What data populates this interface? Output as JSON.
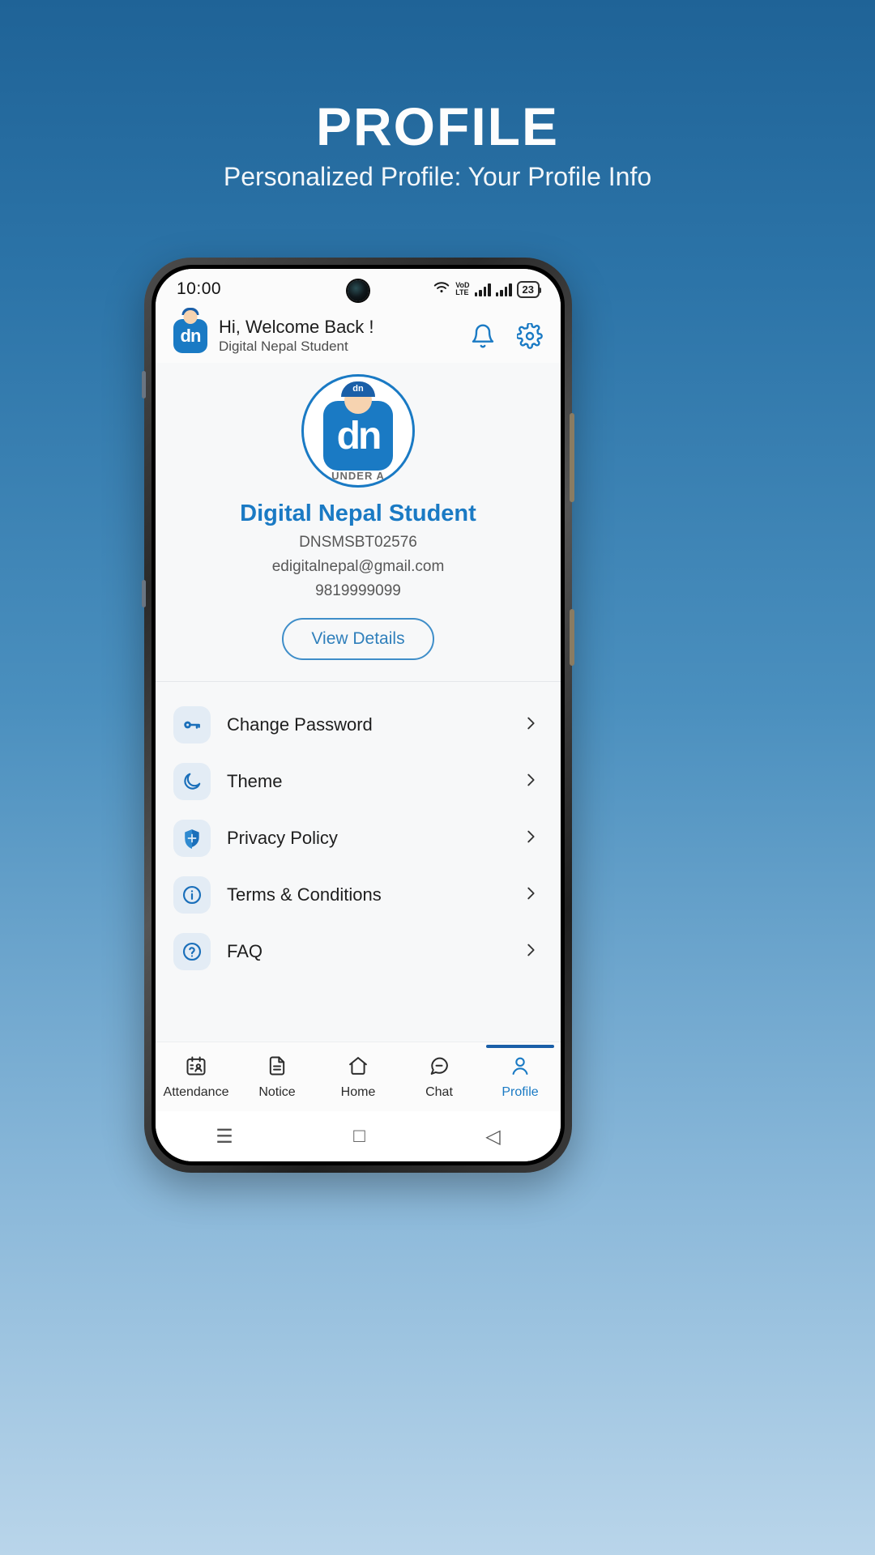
{
  "poster": {
    "title": "PROFILE",
    "subtitle": "Personalized Profile: Your Profile Info"
  },
  "status_bar": {
    "time": "10:00",
    "network_label_top": "VoD",
    "network_label_bottom": "LTE",
    "battery": "23"
  },
  "app_header": {
    "logo_text": "dn",
    "greeting": "Hi, Welcome Back !",
    "username": "Digital Nepal Student",
    "bell_icon": "notification-bell-icon",
    "gear_icon": "settings-gear-icon"
  },
  "profile": {
    "avatar_logo_text": "dn",
    "avatar_badge_text": "dn",
    "avatar_caption": "UNDER A",
    "name": "Digital Nepal Student",
    "id": "DNSMSBT02576",
    "email": "edigitalnepal@gmail.com",
    "phone": "9819999099",
    "view_details_label": "View Details"
  },
  "menu": {
    "items": [
      {
        "label": "Change Password",
        "icon": "key-icon"
      },
      {
        "label": "Theme",
        "icon": "moon-icon"
      },
      {
        "label": "Privacy Policy",
        "icon": "shield-icon"
      },
      {
        "label": "Terms & Conditions",
        "icon": "info-circle-icon"
      },
      {
        "label": "FAQ",
        "icon": "question-circle-icon"
      }
    ]
  },
  "bottom_nav": {
    "items": [
      {
        "label": "Attendance",
        "icon": "attendance-icon",
        "active": false
      },
      {
        "label": "Notice",
        "icon": "document-icon",
        "active": false
      },
      {
        "label": "Home",
        "icon": "home-icon",
        "active": false
      },
      {
        "label": "Chat",
        "icon": "chat-icon",
        "active": false
      },
      {
        "label": "Profile",
        "icon": "person-icon",
        "active": true
      }
    ]
  },
  "system_nav": {
    "recents": "☰",
    "home": "□",
    "back": "◁"
  },
  "colors": {
    "accent": "#1a7ac4",
    "poster_bg_top": "#1f6397",
    "poster_bg_bottom": "#b9d5ea"
  }
}
